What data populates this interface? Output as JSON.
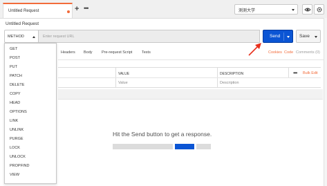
{
  "tabs": {
    "active_label": "Untitled Request",
    "add_label": "+",
    "more_label": "•••"
  },
  "environment": {
    "selected": "测测大学"
  },
  "request": {
    "title": "Untitled Request",
    "method_label": "METHOD",
    "url_placeholder": "Enter request URL",
    "url_value": "",
    "send_label": "Send",
    "save_label": "Save"
  },
  "subtabs": [
    "Headers",
    "Body",
    "Pre-request Script",
    "Tests"
  ],
  "subtab_links": {
    "cookies": "Cookies",
    "code": "Code",
    "comments": "Comments (0)"
  },
  "params_table": {
    "columns": [
      "VALUE",
      "DESCRIPTION"
    ],
    "row_placeholders": [
      "Value",
      "Description"
    ],
    "more_label": "•••",
    "bulk_edit_label": "Bulk Edit"
  },
  "response": {
    "empty_message": "Hit the Send button to get a response."
  },
  "method_menu": {
    "items": [
      "GET",
      "POST",
      "PUT",
      "PATCH",
      "DELETE",
      "COPY",
      "HEAD",
      "OPTIONS",
      "LINK",
      "UNLINK",
      "PURGE",
      "LOCK",
      "UNLOCK",
      "PROPFIND",
      "VIEW"
    ]
  },
  "colors": {
    "accent": "#f26b3a",
    "send_button": "#0b55d4",
    "annotation_arrow": "#e8301c"
  }
}
